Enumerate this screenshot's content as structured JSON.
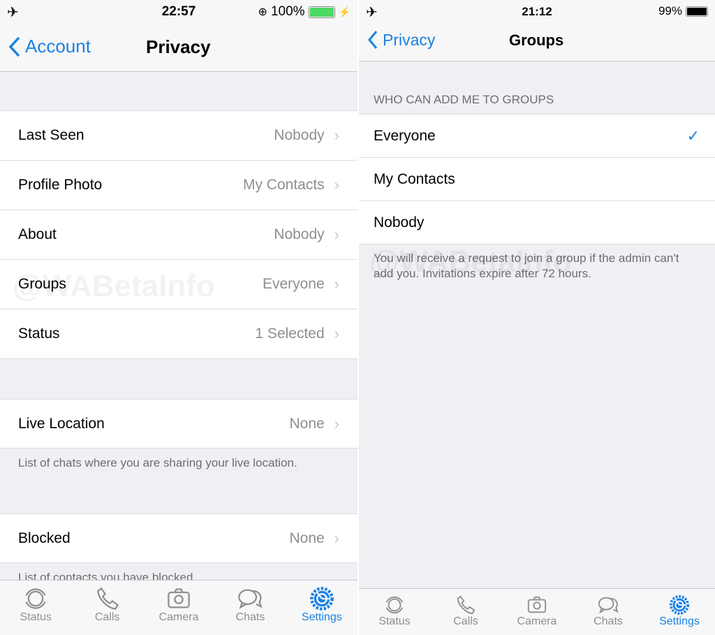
{
  "watermark": "@WABetaInfo",
  "accent": "#1a82e2",
  "left": {
    "status": {
      "time": "22:57",
      "battery": "100%",
      "battery_level": 100,
      "charging": true,
      "battery_color": "#4cd964"
    },
    "nav": {
      "back": "Account",
      "title": "Privacy"
    },
    "rows": [
      {
        "label": "Last Seen",
        "value": "Nobody"
      },
      {
        "label": "Profile Photo",
        "value": "My Contacts"
      },
      {
        "label": "About",
        "value": "Nobody"
      },
      {
        "label": "Groups",
        "value": "Everyone"
      },
      {
        "label": "Status",
        "value": "1 Selected"
      }
    ],
    "live_location": {
      "label": "Live Location",
      "value": "None",
      "footer": "List of chats where you are sharing your live location."
    },
    "blocked": {
      "label": "Blocked",
      "value": "None",
      "footer": "List of contacts you have blocked."
    }
  },
  "right": {
    "status": {
      "time": "21:12",
      "battery": "99%",
      "battery_level": 99
    },
    "nav": {
      "back": "Privacy",
      "title": "Groups"
    },
    "section_header": "WHO CAN ADD ME TO GROUPS",
    "options": [
      {
        "label": "Everyone",
        "selected": true
      },
      {
        "label": "My Contacts",
        "selected": false
      },
      {
        "label": "Nobody",
        "selected": false
      }
    ],
    "footer": "You will receive a request to join a group if the admin can't add you. Invitations expire after 72 hours."
  },
  "tabs": [
    {
      "label": "Status",
      "icon": "status-icon"
    },
    {
      "label": "Calls",
      "icon": "phone-icon"
    },
    {
      "label": "Camera",
      "icon": "camera-icon"
    },
    {
      "label": "Chats",
      "icon": "chats-icon"
    },
    {
      "label": "Settings",
      "icon": "gear-icon",
      "active": true
    }
  ]
}
